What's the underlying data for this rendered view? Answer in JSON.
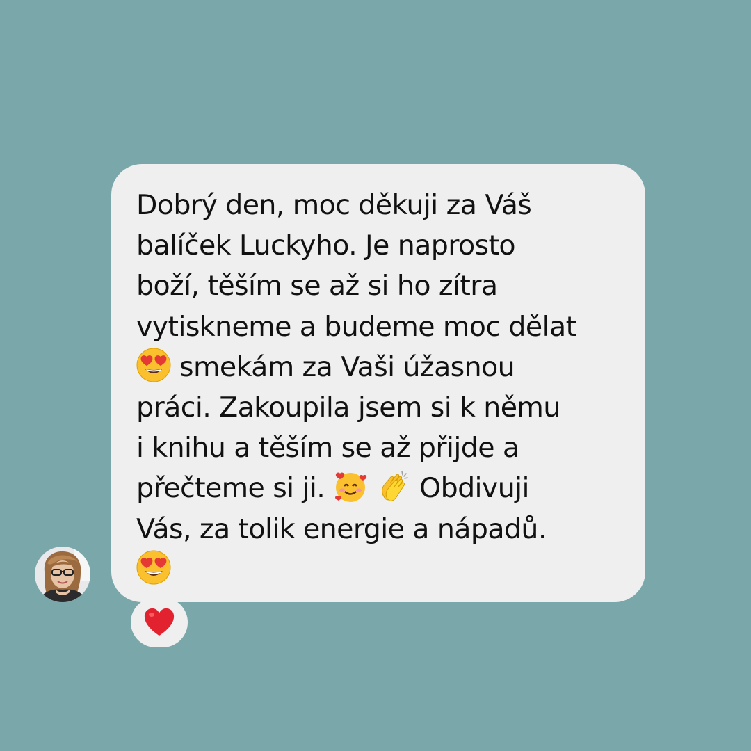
{
  "colors": {
    "background": "#7aa8aa",
    "bubble": "#efefef",
    "text": "#111111",
    "reaction_pill": "#efefef",
    "heart": "#e2232f"
  },
  "message": {
    "lines": [
      "Dobrý den, moc děkuji za Váš",
      "balíček Luckyho. Je naprosto",
      "boží, těším se až si ho zítra",
      "vytiskneme a budeme moc dělat",
      "smekám za Vaši úžasnou",
      "práci. Zakoupila jsem si k němu",
      "i knihu a těším se až přijde a",
      "přečteme si ji.",
      "Obdivuji",
      "Vás, za tolik energie a nápadů."
    ],
    "emojis": {
      "heart_eyes": "heart-eyes-emoji",
      "smiling_hearts": "smiling-face-with-hearts-emoji",
      "clapping": "clapping-hands-emoji"
    }
  },
  "reaction": {
    "icon": "red-heart-icon"
  },
  "avatar": {
    "icon": "user-avatar"
  }
}
